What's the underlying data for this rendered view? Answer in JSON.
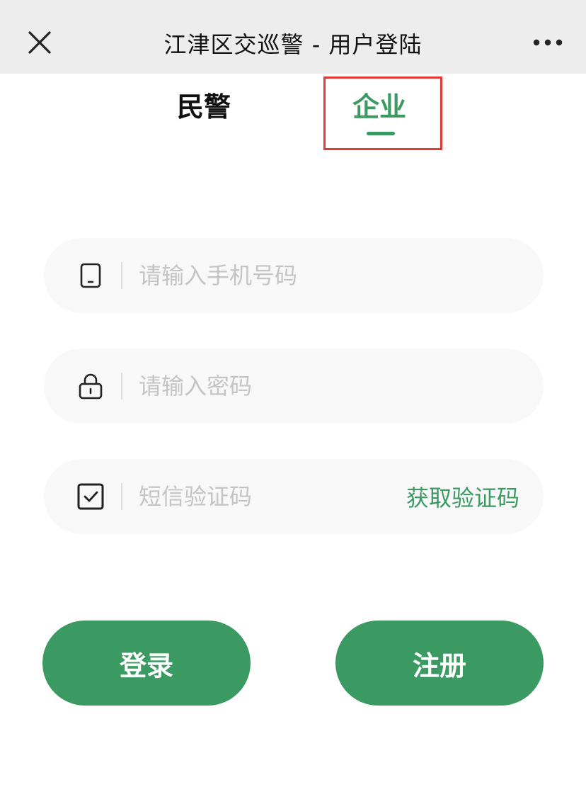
{
  "header": {
    "title": "江津区交巡警 - 用户登陆",
    "close_icon": "close-icon",
    "more_icon": "more-icon"
  },
  "tabs": [
    {
      "label": "民警",
      "active": false
    },
    {
      "label": "企业",
      "active": true
    }
  ],
  "form": {
    "phone": {
      "placeholder": "请输入手机号码",
      "value": "",
      "icon": "phone-icon"
    },
    "password": {
      "placeholder": "请输入密码",
      "value": "",
      "icon": "lock-icon"
    },
    "sms": {
      "placeholder": "短信验证码",
      "value": "",
      "icon": "checkbox-icon",
      "get_code_label": "获取验证码"
    }
  },
  "actions": {
    "login_label": "登录",
    "register_label": "注册"
  },
  "colors": {
    "accent": "#3a9a62",
    "highlight": "#e53935",
    "topbar": "#ededed",
    "field_bg": "#f8f8f8"
  }
}
